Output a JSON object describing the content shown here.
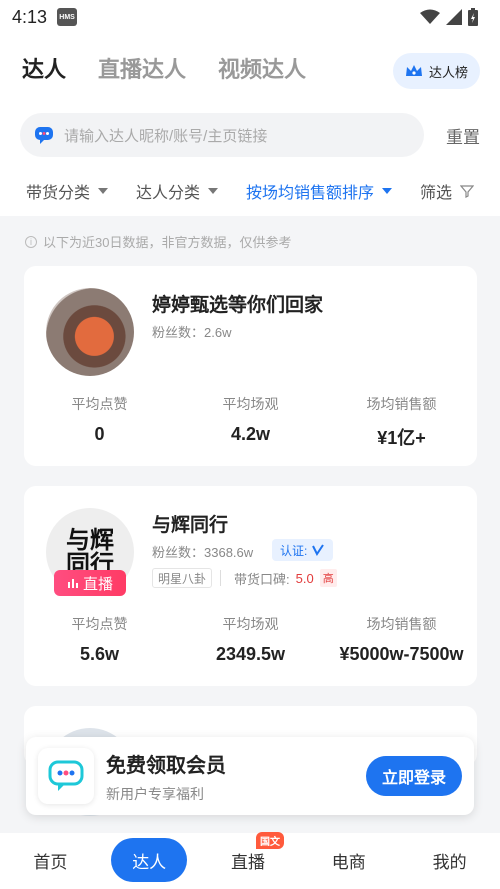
{
  "status": {
    "time": "4:13",
    "hms": "HMS"
  },
  "header": {
    "tabs": [
      {
        "label": "达人"
      },
      {
        "label": "直播达人"
      },
      {
        "label": "视频达人"
      }
    ],
    "rank_label": "达人榜"
  },
  "search": {
    "placeholder": "请输入达人昵称/账号/主页链接",
    "reset_label": "重置"
  },
  "filters": [
    {
      "label": "带货分类"
    },
    {
      "label": "达人分类"
    },
    {
      "label": "按场均销售额排序"
    },
    {
      "label": "筛选"
    }
  ],
  "notice": "以下为近30日数据，非官方数据，仅供参考",
  "cards": [
    {
      "name": "婷婷甄选等你们回家",
      "fans": "粉丝数：2.6w",
      "stats": [
        {
          "label": "平均点赞",
          "value": "0"
        },
        {
          "label": "平均场观",
          "value": "4.2w"
        },
        {
          "label": "场均销售额",
          "value": "¥1亿+"
        }
      ]
    },
    {
      "name": "与辉同行",
      "fans": "粉丝数：3368.6w",
      "verify": "认证:",
      "live": "直播",
      "tag": "明星八卦",
      "reputation_label": "带货口碑:",
      "reputation_score": "5.0",
      "reputation_level": "高",
      "avatar_text": "与辉同行",
      "stats": [
        {
          "label": "平均点赞",
          "value": "5.6w"
        },
        {
          "label": "平均场观",
          "value": "2349.5w"
        },
        {
          "label": "场均销售额",
          "value": "¥5000w-7500w"
        }
      ]
    }
  ],
  "promo": {
    "title": "免费领取会员",
    "subtitle": "新用户专享福利",
    "button": "立即登录"
  },
  "bottom_nav": [
    {
      "label": "首页"
    },
    {
      "label": "达人"
    },
    {
      "label": "直播",
      "badge": "国文"
    },
    {
      "label": "电商"
    },
    {
      "label": "我的"
    }
  ],
  "colors": {
    "accent": "#1e74f0",
    "live": "#ff3b65",
    "reputation": "#e23b3b"
  }
}
